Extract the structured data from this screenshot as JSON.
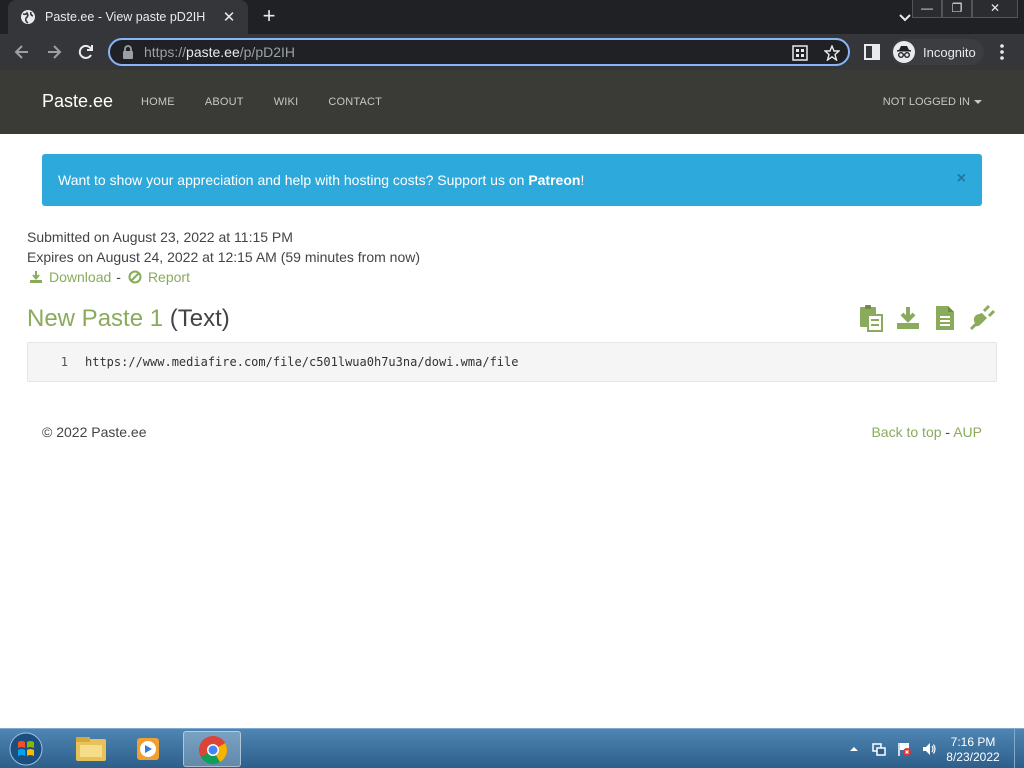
{
  "browser": {
    "tab_title": "Paste.ee - View paste pD2IH",
    "tab_close": "✕",
    "new_tab": "+",
    "url_scheme": "https://",
    "url_host": "paste.ee",
    "url_path": "/p/pD2IH",
    "profile_label": "Incognito"
  },
  "navbar": {
    "brand": "Paste.ee",
    "links": [
      "HOME",
      "ABOUT",
      "WIKI",
      "CONTACT"
    ],
    "login": "NOT LOGGED IN"
  },
  "alert": {
    "text": "Want to show your appreciation and help with hosting costs? Support us on ",
    "link": "Patreon",
    "suffix": "!",
    "close": "×"
  },
  "paste": {
    "submitted": "Submitted on August 23, 2022 at 11:15 PM",
    "expires": "Expires on August 24, 2022 at 12:15 AM (59 minutes from now)",
    "download": "Download",
    "separator": "-",
    "report": "Report",
    "name": "New Paste 1",
    "syntax": "(Text)",
    "lines": [
      {
        "number": "1",
        "text": "https://www.mediafire.com/file/c501lwua0h7u3na/dowi.wma/file"
      }
    ]
  },
  "footer": {
    "copyright": "© 2022 Paste.ee",
    "back_to_top": "Back to top",
    "separator": "-",
    "aup": "AUP"
  },
  "taskbar": {
    "time": "7:16 PM",
    "date": "8/23/2022"
  },
  "colors": {
    "accent_green": "#8aab5b",
    "alert_blue": "#2ea9dc",
    "navbar": "#3a3a36"
  }
}
